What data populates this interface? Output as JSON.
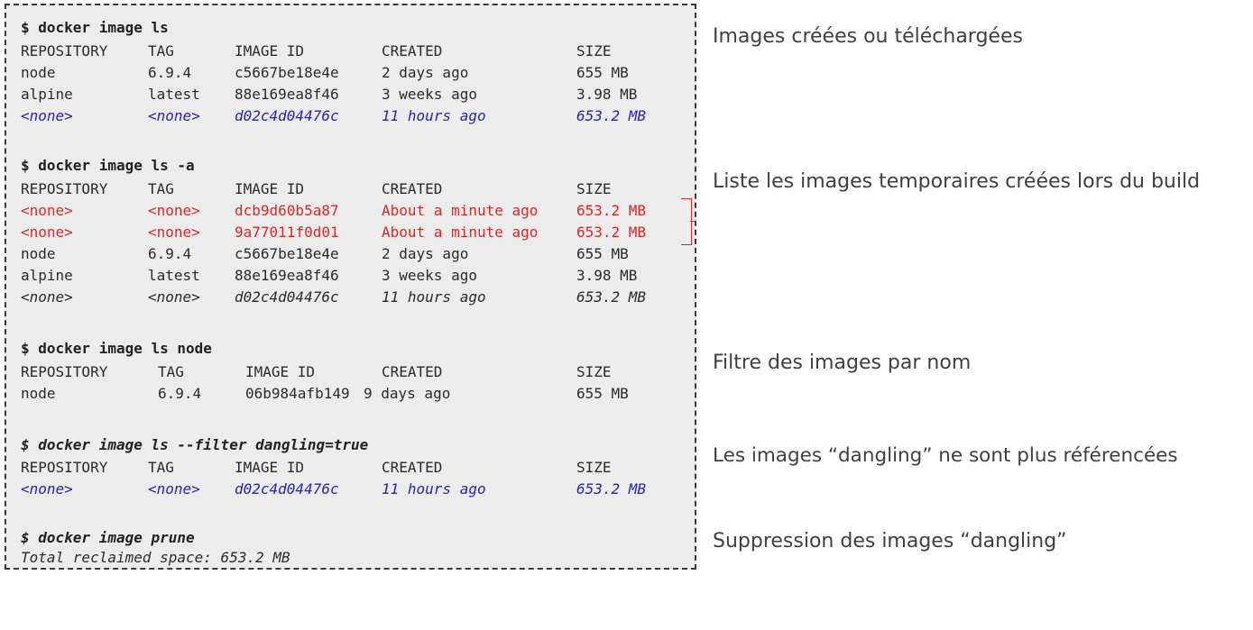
{
  "sections": [
    {
      "command": "$ docker image ls",
      "rows": [
        [
          "REPOSITORY",
          "TAG",
          "IMAGE ID",
          "CREATED",
          "SIZE"
        ],
        [
          "node",
          "6.9.4",
          "c5667be18e4e",
          "2 days ago",
          "655 MB"
        ],
        [
          "alpine",
          "latest",
          "88e169ea8f46",
          "3 weeks ago",
          "3.98 MB"
        ],
        [
          "<none>",
          "<none>",
          "d02c4d04476c",
          "11 hours ago",
          "653.2 MB"
        ]
      ],
      "note": "Images créées ou téléchargées"
    },
    {
      "command": "$ docker image ls -a",
      "rows": [
        [
          "REPOSITORY",
          "TAG",
          "IMAGE ID",
          "CREATED",
          "SIZE"
        ],
        [
          "<none>",
          "<none>",
          "dcb9d60b5a87",
          "About a minute ago",
          "653.2 MB"
        ],
        [
          "<none>",
          "<none>",
          "9a77011f0d01",
          "About a minute ago",
          "653.2 MB"
        ],
        [
          "node",
          "6.9.4",
          "c5667be18e4e",
          "2 days ago",
          "655 MB"
        ],
        [
          "alpine",
          "latest",
          "88e169ea8f46",
          "3 weeks ago",
          "3.98 MB"
        ],
        [
          "<none>",
          "<none>",
          "d02c4d04476c",
          "11 hours ago",
          "653.2 MB"
        ]
      ],
      "note": "Liste les images temporaires créées lors du build"
    },
    {
      "command": "$ docker image ls node",
      "rows": [
        [
          "REPOSITORY",
          "TAG",
          "IMAGE ID",
          "CREATED",
          "SIZE"
        ],
        [
          "node",
          "6.9.4",
          "06b984afb149",
          "9 days ago",
          "655 MB"
        ]
      ],
      "note": "Filtre des images par nom"
    },
    {
      "command": "$ docker image ls --filter dangling=true",
      "rows": [
        [
          "REPOSITORY",
          "TAG",
          "IMAGE ID",
          "CREATED",
          "SIZE"
        ],
        [
          "<none>",
          "<none>",
          "d02c4d04476c",
          "11 hours ago",
          "653.2 MB"
        ]
      ],
      "note": "Les images “dangling” ne sont plus référencées"
    },
    {
      "command": "$ docker image prune",
      "output": "Total reclaimed space: 653.2 MB",
      "note": "Suppression des images “dangling”"
    }
  ],
  "colors": {
    "highlight_blue": "#2424b8",
    "highlight_red": "#d42a2a",
    "terminal_bg": "#ececec"
  }
}
